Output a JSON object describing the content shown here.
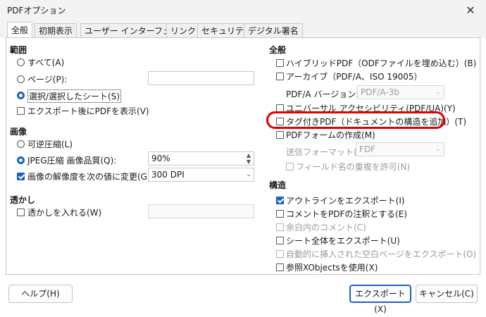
{
  "window": {
    "title": "PDFオプション",
    "close_glyph": "✕"
  },
  "tabs": [
    {
      "label": "全般"
    },
    {
      "label": "初期表示"
    },
    {
      "label": "ユーザー インターフェイス"
    },
    {
      "label": "リンク"
    },
    {
      "label": "セキュリティ"
    },
    {
      "label": "デジタル署名"
    }
  ],
  "range": {
    "header": "範囲",
    "all": "すべて(A)",
    "pages": "ページ(P):",
    "pages_value": "",
    "selection": "選択/選択したシート(S)",
    "selected": "selection",
    "view_after_export": "エクスポート後にPDFを表示(V)",
    "view_after_export_checked": false
  },
  "image": {
    "header": "画像",
    "lossless": "可逆圧縮(L)",
    "jpeg": "JPEG圧縮  画像品質(Q):",
    "jpeg_quality": "90%",
    "selected": "jpeg",
    "reduce_resolution": "画像の解像度を次の値に変更(G):",
    "reduce_resolution_checked": true,
    "resolution_value": "300 DPI"
  },
  "watermark": {
    "header": "透かし",
    "sign": "透かしを入れる(W)",
    "sign_checked": false,
    "text_value": ""
  },
  "general": {
    "header": "全般",
    "hybrid": "ハイブリッドPDF（ODFファイルを埋め込む）(B)",
    "archive": "アーカイブ（PDF/A、ISO 19005）",
    "pdfa_version_label": "PDF/A バージョン:",
    "pdfa_version_value": "PDF/A-3b",
    "ua": "ユニバーサル アクセシビリティ(PDF/UA)(Y)",
    "tagged": "タグ付きPDF（ドキュメントの構造を追加）(T)",
    "form": "PDFフォームの作成(M)",
    "submit_format_label": "送信フォーマット(F):",
    "submit_format_value": "FDF",
    "allow_duplicate": "フィールド名の重複を許可(N)"
  },
  "structure": {
    "header": "構造",
    "outline": "アウトラインをエクスポート(I)",
    "outline_checked": true,
    "comments": "コメントをPDFの注釈とする(E)",
    "comments_in_margin": "余白内のコメント(C)",
    "full_sheet": "シート全体をエクスポート(U)",
    "blank_pages": "自動的に挿入された空白ページをエクスポート(O)",
    "xobjects": "参照XObjectsを使用(X)"
  },
  "buttons": {
    "help": "ヘルプ(H)",
    "export": "エクスポート(X)",
    "cancel": "キャンセル(C)"
  },
  "colors": {
    "accent": "#1a62c4",
    "highlight": "#e30000"
  }
}
